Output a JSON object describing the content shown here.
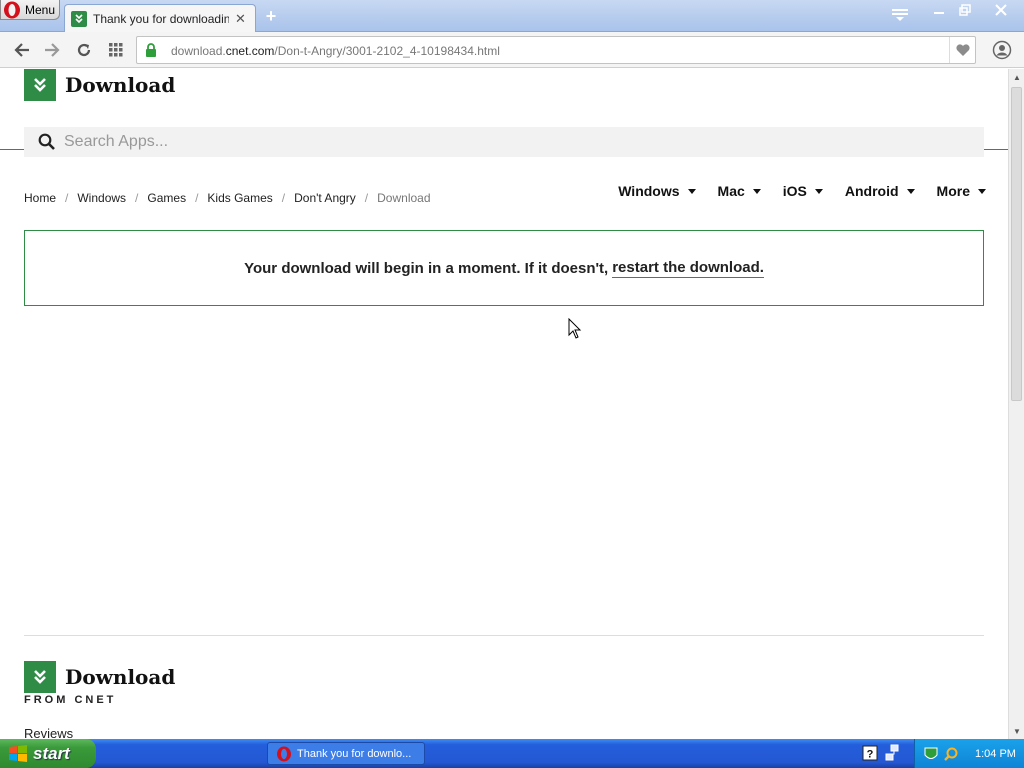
{
  "browser": {
    "menu_label": "Menu",
    "tab_title": "Thank you for downloading Don't Angry",
    "new_tab": "+",
    "url_prefix": "download.",
    "url_domain": "cnet.com",
    "url_path": "/Don-t-Angry/3001-2102_4-10198434.html"
  },
  "site": {
    "logo_text": "Download",
    "search_placeholder": "Search Apps...",
    "breadcrumb": [
      "Home",
      "Windows",
      "Games",
      "Kids Games",
      "Don't Angry"
    ],
    "breadcrumb_current": "Download",
    "breadcrumb_sep": "/",
    "platform_nav": [
      "Windows",
      "Mac",
      "iOS",
      "Android",
      "More"
    ],
    "notice_text": "Your download will begin in a moment. If it doesn't,",
    "notice_link": "restart the download.",
    "footer_logo_text": "Download",
    "footer_from": "FROM CNET",
    "footer_reviews": "Reviews"
  },
  "taskbar": {
    "start_label": "start",
    "task_label": "Thank you for downlo...",
    "clock": "1:04 PM"
  },
  "colors": {
    "brand_green": "#2f8c46",
    "taskbar_blue": "#245edb"
  },
  "icons": [
    "opera-icon",
    "favicon-download-icon",
    "tab-close-icon",
    "new-tab-icon",
    "tab-menu-icon",
    "minimize-icon",
    "restore-icon",
    "close-icon",
    "back-icon",
    "forward-icon",
    "reload-icon",
    "speed-dial-icon",
    "lock-icon",
    "heart-icon",
    "profile-icon",
    "search-icon",
    "windows-flag-icon",
    "help-icon",
    "network-icon",
    "tray-security-icon",
    "tray-search-icon"
  ]
}
